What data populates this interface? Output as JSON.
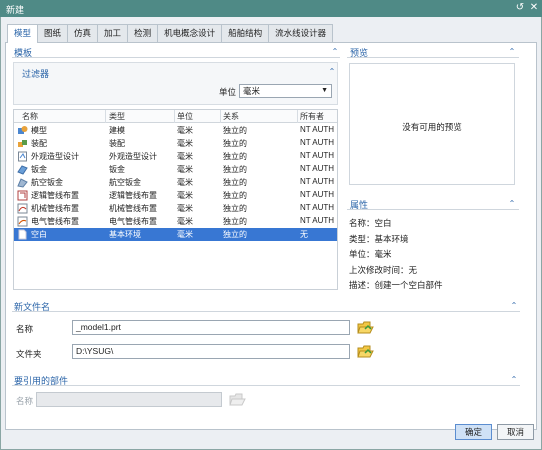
{
  "window": {
    "title": "新建",
    "colors": {
      "titlebar": "#4f8a86",
      "accent": "#2a64a8",
      "selection": "#3877d3"
    }
  },
  "tabs": [
    {
      "label": "模型",
      "active": true
    },
    {
      "label": "图纸"
    },
    {
      "label": "仿真"
    },
    {
      "label": "加工"
    },
    {
      "label": "检测"
    },
    {
      "label": "机电概念设计"
    },
    {
      "label": "船舶结构"
    },
    {
      "label": "流水线设计器"
    }
  ],
  "templates": {
    "section_title": "模板",
    "filter": {
      "title": "过滤器",
      "unit_label": "单位",
      "unit_value": "毫米"
    },
    "columns": [
      "名称",
      "类型",
      "单位",
      "关系",
      "所有者"
    ],
    "rows": [
      {
        "name": "模型",
        "type": "建模",
        "unit": "毫米",
        "relation": "独立的",
        "owner": "NT AUTH",
        "icon": "model-icon"
      },
      {
        "name": "装配",
        "type": "装配",
        "unit": "毫米",
        "relation": "独立的",
        "owner": "NT AUTH",
        "icon": "assembly-icon"
      },
      {
        "name": "外观造型设计",
        "type": "外观造型设计",
        "unit": "毫米",
        "relation": "独立的",
        "owner": "NT AUTH",
        "icon": "shape-studio-icon"
      },
      {
        "name": "钣金",
        "type": "钣金",
        "unit": "毫米",
        "relation": "独立的",
        "owner": "NT AUTH",
        "icon": "sheet-metal-icon"
      },
      {
        "name": "航空钣金",
        "type": "航空钣金",
        "unit": "毫米",
        "relation": "独立的",
        "owner": "NT AUTH",
        "icon": "aero-sheet-metal-icon"
      },
      {
        "name": "逻辑管线布置",
        "type": "逻辑管线布置",
        "unit": "毫米",
        "relation": "独立的",
        "owner": "NT AUTH",
        "icon": "logical-routing-icon"
      },
      {
        "name": "机械管线布置",
        "type": "机械管线布置",
        "unit": "毫米",
        "relation": "独立的",
        "owner": "NT AUTH",
        "icon": "mechanical-routing-icon"
      },
      {
        "name": "电气管线布置",
        "type": "电气管线布置",
        "unit": "毫米",
        "relation": "独立的",
        "owner": "NT AUTH",
        "icon": "electrical-routing-icon"
      },
      {
        "name": "空白",
        "type": "基本环境",
        "unit": "毫米",
        "relation": "独立的",
        "owner": "无",
        "icon": "blank-icon",
        "selected": true
      }
    ]
  },
  "preview": {
    "title": "预览",
    "empty_text": "没有可用的预览"
  },
  "properties": {
    "title": "属性",
    "items": [
      {
        "text": "名称：空白"
      },
      {
        "text": "类型：基本环境"
      },
      {
        "text": "单位：毫米"
      },
      {
        "text": "上次修改时间：无"
      },
      {
        "text": "描述：创建一个空白部件"
      }
    ]
  },
  "new_file": {
    "title": "新文件名",
    "name_label": "名称",
    "name_value": "_model1.prt",
    "folder_label": "文件夹",
    "folder_value": "D:\\YSUG\\"
  },
  "referenced_part": {
    "title": "要引用的部件",
    "name_label": "名称",
    "name_value": ""
  },
  "buttons": {
    "ok": "确定",
    "cancel": "取消"
  }
}
